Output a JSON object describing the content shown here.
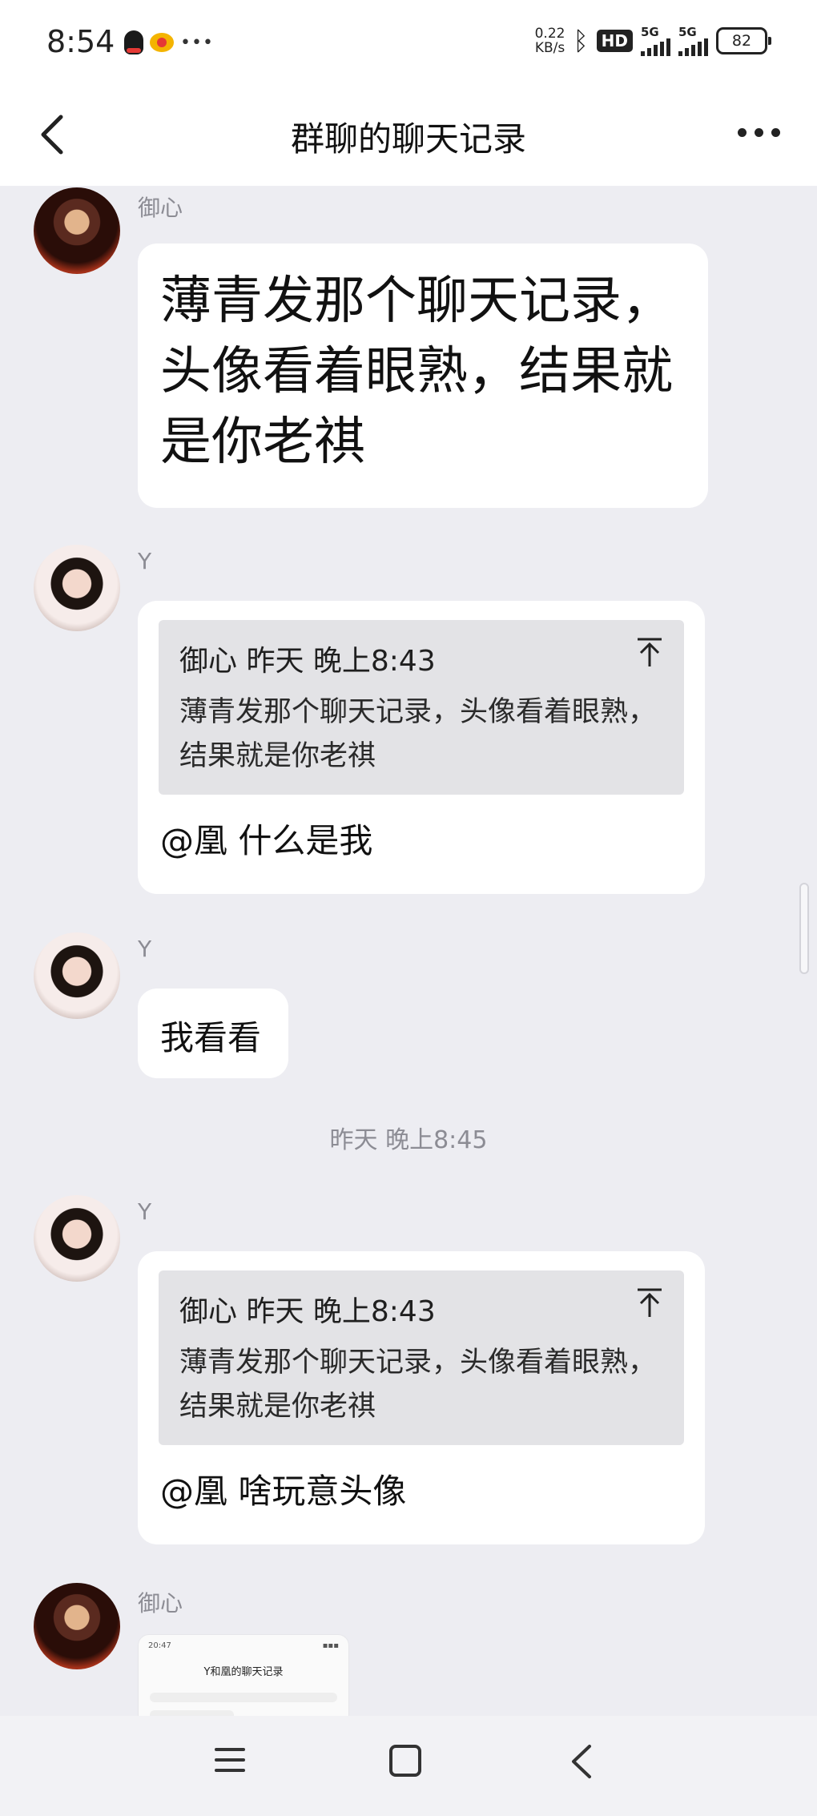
{
  "status_bar": {
    "time": "8:54",
    "net_speed_value": "0.22",
    "net_speed_unit": "KB/s",
    "hd_badge": "HD",
    "signal1": "5G",
    "signal2": "5G",
    "battery": "82",
    "overflow": "•••"
  },
  "header": {
    "title": "群聊的聊天记录"
  },
  "messages": [
    {
      "sender": "御心",
      "text": "薄青发那个聊天记录，头像看着眼熟，结果就是你老祺"
    },
    {
      "sender": "Y",
      "quote_head": "御心  昨天  晚上8:43",
      "quote_body": "薄青发那个聊天记录，头像看着眼熟，结果就是你老祺",
      "reply": "@凰  什么是我"
    },
    {
      "sender": "Y",
      "text": "我看看"
    },
    {
      "timestamp": "昨天  晚上8:45"
    },
    {
      "sender": "Y",
      "quote_head": "御心  昨天  晚上8:43",
      "quote_body": "薄青发那个聊天记录，头像看着眼熟，结果就是你老祺",
      "reply": "@凰  啥玩意头像"
    },
    {
      "sender": "御心",
      "image_title": "Y和凰的聊天记录",
      "image_time": "20:47"
    }
  ],
  "colors": {
    "background": "#ededf2",
    "bubble": "#ffffff",
    "quote": "#e3e3e6",
    "secondary_text": "#8c8c94"
  }
}
